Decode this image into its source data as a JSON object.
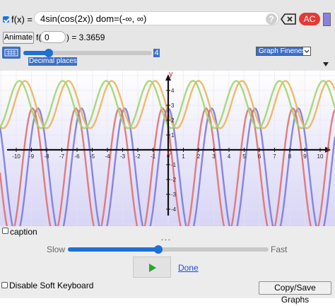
{
  "function_row": {
    "fx_label": "f(x) =",
    "expression": "4sin(cos(2x))  dom=(-∞, ∞)",
    "help_label": "?",
    "clear_label": "AC",
    "color_swatch": "#8b80e0"
  },
  "eval_row": {
    "animate_label": "Animate",
    "f_label": "f(",
    "input_value": "0",
    "result_label": ") = 3.3659"
  },
  "decimal_row": {
    "decimal_value": "4",
    "decimal_label": "Decimal places",
    "fineness_label": "Graph Fineness",
    "decimal_fraction": 0.2
  },
  "graph": {
    "x_axis_label": "x",
    "y_axis_label": "y",
    "x_ticks": [
      "-10",
      "-9",
      "-8",
      "-7",
      "-6",
      "-5",
      "-4",
      "-3",
      "-2",
      "-1",
      "0",
      "1",
      "2",
      "3",
      "4",
      "5",
      "6",
      "7",
      "8",
      "9",
      "10"
    ],
    "y_ticks": [
      "4",
      "3",
      "2",
      "1",
      "-1",
      "-2",
      "-3",
      "-4"
    ],
    "curve_colors": [
      "#7b7bdc",
      "#e07070",
      "#ecb458",
      "#9ed66a"
    ]
  },
  "controls": {
    "caption_label": "caption",
    "slow_label": "Slow",
    "fast_label": "Fast",
    "done_label": "Done",
    "speed_fraction": 0.45,
    "play_color": "#1faa2d"
  },
  "footer": {
    "soft_keyboard_label": "Disable Soft Keyboard",
    "copy_save_label": "Copy/Save Graphs"
  }
}
